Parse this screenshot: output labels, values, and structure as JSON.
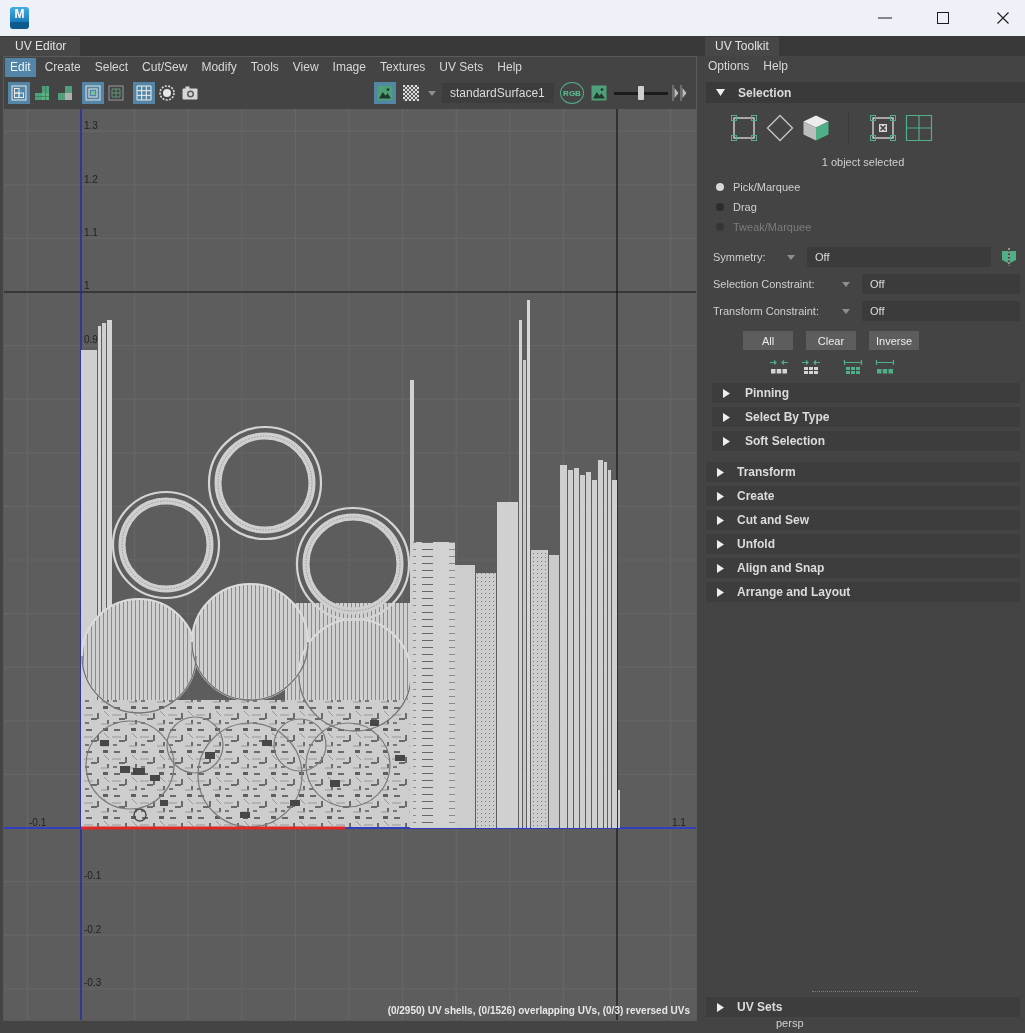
{
  "window": {
    "app_icon_letter": "M"
  },
  "uv_editor": {
    "tab": "UV Editor",
    "menu": [
      {
        "label": "Edit",
        "selected": true
      },
      {
        "label": "Create",
        "selected": false
      },
      {
        "label": "Select",
        "selected": false
      },
      {
        "label": "Cut/Sew",
        "selected": false
      },
      {
        "label": "Modify",
        "selected": false
      },
      {
        "label": "Tools",
        "selected": false
      },
      {
        "label": "View",
        "selected": false
      },
      {
        "label": "Image",
        "selected": false
      },
      {
        "label": "Textures",
        "selected": false
      },
      {
        "label": "UV Sets",
        "selected": false
      },
      {
        "label": "Help",
        "selected": false
      }
    ],
    "tool_groups": [
      {
        "tools": [
          {
            "kind": "shell-grid",
            "selected": true
          },
          {
            "kind": "green-stack",
            "selected": false
          },
          {
            "kind": "green-grey-stack",
            "selected": false
          }
        ]
      },
      {
        "tools": [
          {
            "kind": "frame",
            "selected": true
          },
          {
            "kind": "grid-frame",
            "selected": false
          }
        ]
      },
      {
        "tools": [
          {
            "kind": "grid",
            "selected": true
          },
          {
            "kind": "dotted-circle",
            "selected": false
          },
          {
            "kind": "camera",
            "selected": false
          }
        ]
      }
    ],
    "display_tools": [
      {
        "kind": "picture",
        "selected": true
      },
      {
        "kind": "checker",
        "selected": false
      }
    ],
    "material": "standardSurface1",
    "channel_tools": [
      {
        "kind": "rgb",
        "label": "RGB",
        "selected": false
      },
      {
        "kind": "picture",
        "selected": false
      }
    ],
    "exposure": {
      "level": 0.5
    },
    "v_axis_labels": [
      "1.3",
      "1.2",
      "1.1",
      "1",
      "0.9",
      "-0.1",
      "-0.2",
      "-0.3"
    ],
    "u_axis_labels": [
      "-0.1",
      "1.1"
    ],
    "status": "(0/2950) UV shells, (0/1526) overlapping UVs, (0/3) reversed UVs"
  },
  "uv_toolkit": {
    "tab": "UV Toolkit",
    "menu": [
      "Options",
      "Help"
    ],
    "selection": {
      "title": "Selection",
      "expanded": true,
      "tool_groups": [
        {
          "tools": [
            {
              "kind": "handles-square"
            },
            {
              "kind": "diamond"
            },
            {
              "kind": "cube"
            }
          ]
        },
        {
          "tools": [
            {
              "kind": "marked-square"
            },
            {
              "kind": "four-grid"
            }
          ]
        }
      ],
      "status": "1 object selected",
      "modes": [
        {
          "label": "Pick/Marquee",
          "selected": true,
          "disabled": false
        },
        {
          "label": "Drag",
          "selected": false,
          "disabled": false
        },
        {
          "label": "Tweak/Marquee",
          "selected": false,
          "disabled": true
        }
      ],
      "fields": [
        {
          "kind": "symmetry",
          "label": "Symmetry:",
          "value": "Off"
        },
        {
          "kind": "constraint",
          "label": "Selection Constraint:",
          "value": "Off"
        },
        {
          "kind": "constraint",
          "label": "Transform Constraint:",
          "value": "Off"
        }
      ],
      "buttons": [
        "All",
        "Clear",
        "Inverse"
      ],
      "quick_groups": [
        {
          "tools": [
            {
              "kind": "inward-row"
            },
            {
              "kind": "inward-grid"
            }
          ]
        },
        {
          "tools": [
            {
              "kind": "span-grid"
            },
            {
              "kind": "span-row"
            }
          ]
        }
      ],
      "subsections": [
        {
          "title": "Pinning",
          "expanded": false
        },
        {
          "title": "Select By Type",
          "expanded": false
        },
        {
          "title": "Soft Selection",
          "expanded": false
        }
      ]
    },
    "sections": [
      {
        "title": "Transform",
        "expanded": false
      },
      {
        "title": "Create",
        "expanded": false
      },
      {
        "title": "Cut and Sew",
        "expanded": false
      },
      {
        "title": "Unfold",
        "expanded": false
      },
      {
        "title": "Align and Snap",
        "expanded": false
      },
      {
        "title": "Arrange and Layout",
        "expanded": false
      }
    ],
    "footer_section": {
      "title": "UV Sets",
      "expanded": false
    }
  },
  "viewport_label": "persp"
}
